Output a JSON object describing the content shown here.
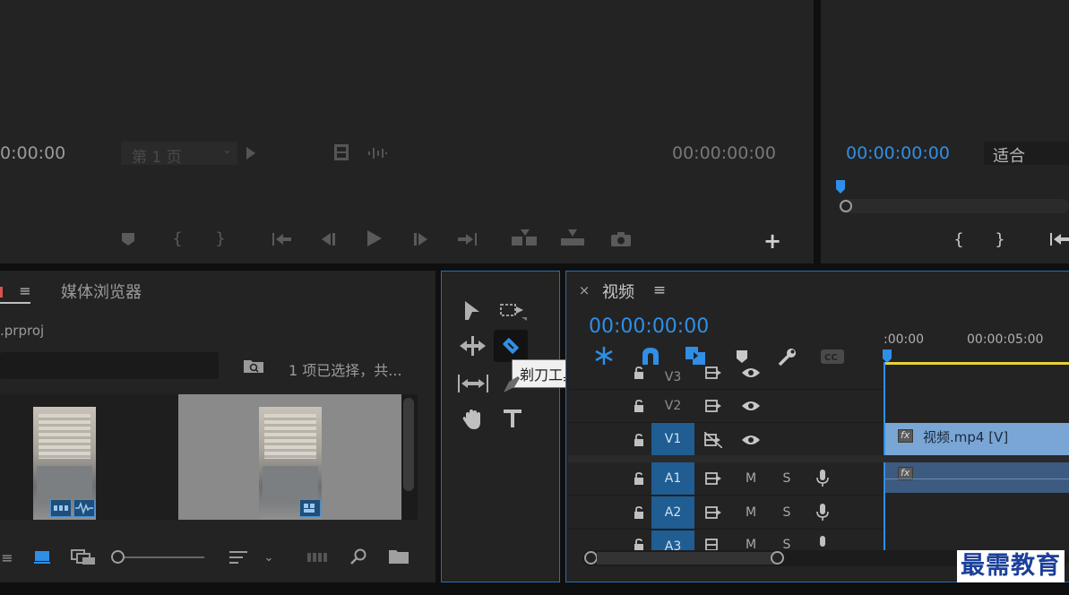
{
  "source_monitor": {
    "timecode_left": "0:00:00",
    "page_select": "第 1 页",
    "timecode_right": "00:00:00:00"
  },
  "program_monitor": {
    "timecode": "00:00:00:00",
    "fit_select": "适合"
  },
  "project_panel": {
    "tab_media_browser": "媒体浏览器",
    "project_file": ".prproj",
    "selection_info": "1 项已选择，共..."
  },
  "tools_panel": {
    "tooltip": "剃刀工具 (C)"
  },
  "timeline": {
    "tab_title": "视频",
    "close_glyph": "×",
    "menu_glyph": "≡",
    "timecode": "00:00:00:00",
    "ruler_labels": [
      ":00:00",
      "00:00:05:00"
    ],
    "tracks": {
      "v3": "V3",
      "v2": "V2",
      "v1": "V1",
      "a1": "A1",
      "a2": "A2",
      "a3": "A3",
      "m": "M",
      "s": "S"
    },
    "clip_video": "视频.mp4 [V]",
    "fx_label": "fx"
  },
  "watermark": "最需教育",
  "colors": {
    "accent_blue": "#2f8fe6",
    "track_target_blue": "#1f5d92",
    "video_clip": "#7aa6d6",
    "audio_clip": "#3d5a80",
    "playhead_yellow": "#e8d23a"
  }
}
